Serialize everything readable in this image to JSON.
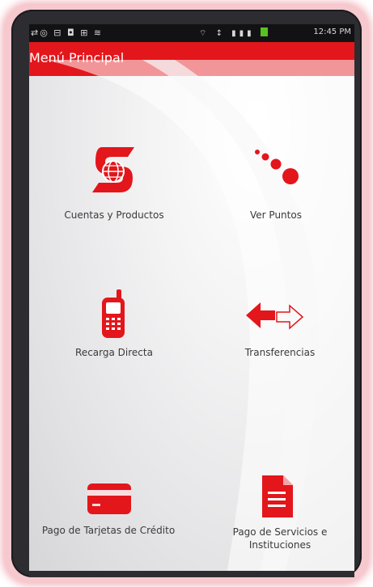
{
  "status_bar": {
    "left_icons": "⇄◎ ⊟ ◘ ⊞ ≋",
    "right_icons": "⌔ ↕ ▮▮▮",
    "time": "12:45 PM"
  },
  "app_bar": {
    "title": "Menú Principal"
  },
  "menu_items": [
    {
      "label": "Cuentas y Productos",
      "icon": "scotiabank-globe-logo-icon"
    },
    {
      "label": "Ver Puntos",
      "icon": "points-dots-icon"
    },
    {
      "label": "Recarga Directa",
      "icon": "mobile-phone-icon"
    },
    {
      "label": "Transferencias",
      "icon": "transfer-arrows-icon"
    },
    {
      "label": "Pago de Tarjetas de Crédito",
      "icon": "credit-card-icon"
    },
    {
      "label": "Pago de Servicios e",
      "label2": "Instituciones",
      "icon": "document-icon"
    }
  ],
  "colors": {
    "accent": "#e3161b",
    "status_bar": "#121214",
    "frame": "#2d2d31",
    "glow": "#f3b7bf"
  }
}
